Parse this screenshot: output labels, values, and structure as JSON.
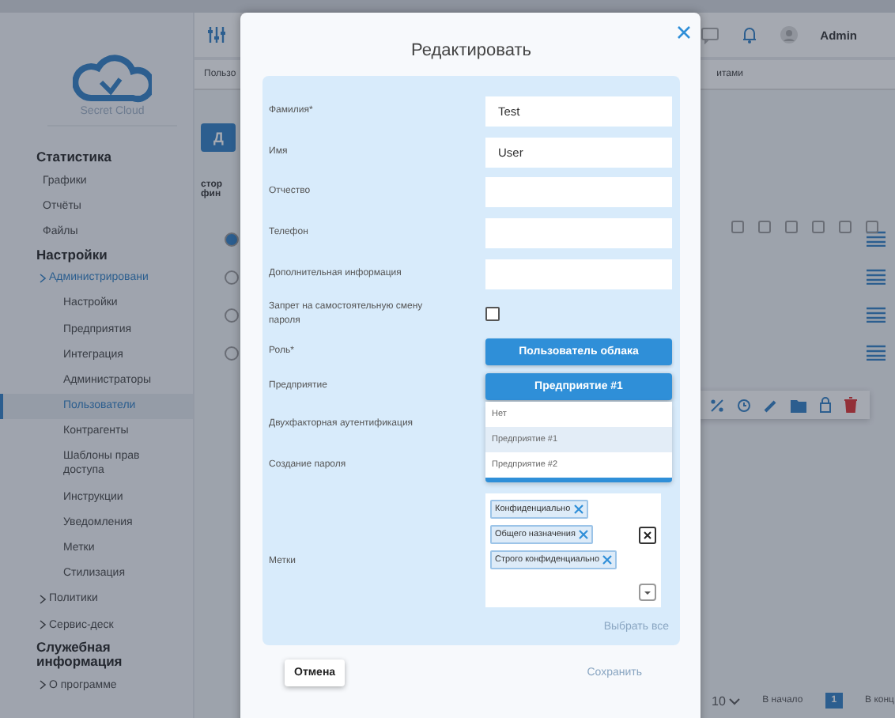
{
  "sidebar": {
    "brand": "Secret Cloud",
    "sections": [
      {
        "title": "Статистика",
        "items": [
          {
            "label": "Графики",
            "selected": false
          },
          {
            "label": "Отчёты",
            "selected": false
          },
          {
            "label": "Файлы",
            "selected": false
          }
        ]
      },
      {
        "title": "Настройки",
        "items": [
          {
            "label": "Администрировани",
            "selected": false,
            "expanded": true,
            "children": [
              {
                "label": "Настройки",
                "selected": false
              },
              {
                "label": "Предприятия",
                "selected": false
              },
              {
                "label": "Интеграция",
                "selected": false
              },
              {
                "label": "Администраторы",
                "selected": false
              },
              {
                "label": "Пользователи",
                "selected": true
              },
              {
                "label": "Контрагенты",
                "selected": false
              },
              {
                "label": "Шаблоны прав доступа",
                "selected": false
              },
              {
                "label": "Инструкции",
                "selected": false
              },
              {
                "label": "Уведомления",
                "selected": false
              },
              {
                "label": "Метки",
                "selected": false
              },
              {
                "label": "Стилизация",
                "selected": false
              }
            ]
          },
          {
            "label": "Политики",
            "selected": false,
            "expanded": false
          },
          {
            "label": "Сервис-деск",
            "selected": false,
            "expanded": false
          }
        ]
      },
      {
        "title": "Служебная информация",
        "items": [
          {
            "label": "О программе",
            "selected": false,
            "expanded": false
          }
        ]
      }
    ]
  },
  "header": {
    "user": "Admin"
  },
  "tabs": [
    {
      "label": "Пользо"
    },
    {
      "label": "итами"
    }
  ],
  "content": {
    "button": "Д",
    "text": [
      "стор",
      "фин"
    ]
  },
  "pagination": {
    "page_size": "10",
    "first": "В начало",
    "page": "1",
    "last": "В конц"
  },
  "modal": {
    "title": "Редактировать",
    "fields": [
      {
        "kind": "text",
        "label": "Фамилия*",
        "value": "Test"
      },
      {
        "kind": "text",
        "label": "Имя",
        "value": "User"
      },
      {
        "kind": "text",
        "label": "Отчество"
      },
      {
        "kind": "text",
        "label": "Телефон"
      },
      {
        "kind": "text",
        "label": "Дополнительная информация"
      },
      {
        "kind": "checkbox",
        "label": "Запрет на самостоятельную смену пароля",
        "checked": false
      },
      {
        "kind": "select",
        "label": "Роль*",
        "value": "Пользователь облака"
      },
      {
        "kind": "select",
        "label": "Предприятие",
        "value": "Предприятие #1",
        "expanded": true,
        "options": [
          {
            "label": "Нет",
            "selected": false
          },
          {
            "label": "Предприятие #1",
            "selected": true
          },
          {
            "label": "Предприятие #2",
            "selected": false
          }
        ]
      },
      {
        "kind": "covered",
        "label": "Двухфакторная аутентификация"
      },
      {
        "kind": "covered",
        "label": "Создание пароля"
      },
      {
        "kind": "tags",
        "label": "Метки",
        "tags": [
          "Конфиденциально",
          "Общего назначения",
          "Строго конфиденциально"
        ],
        "select_all": "Выбрать все"
      }
    ],
    "cancel": "Отмена",
    "save": "Сохранить"
  }
}
